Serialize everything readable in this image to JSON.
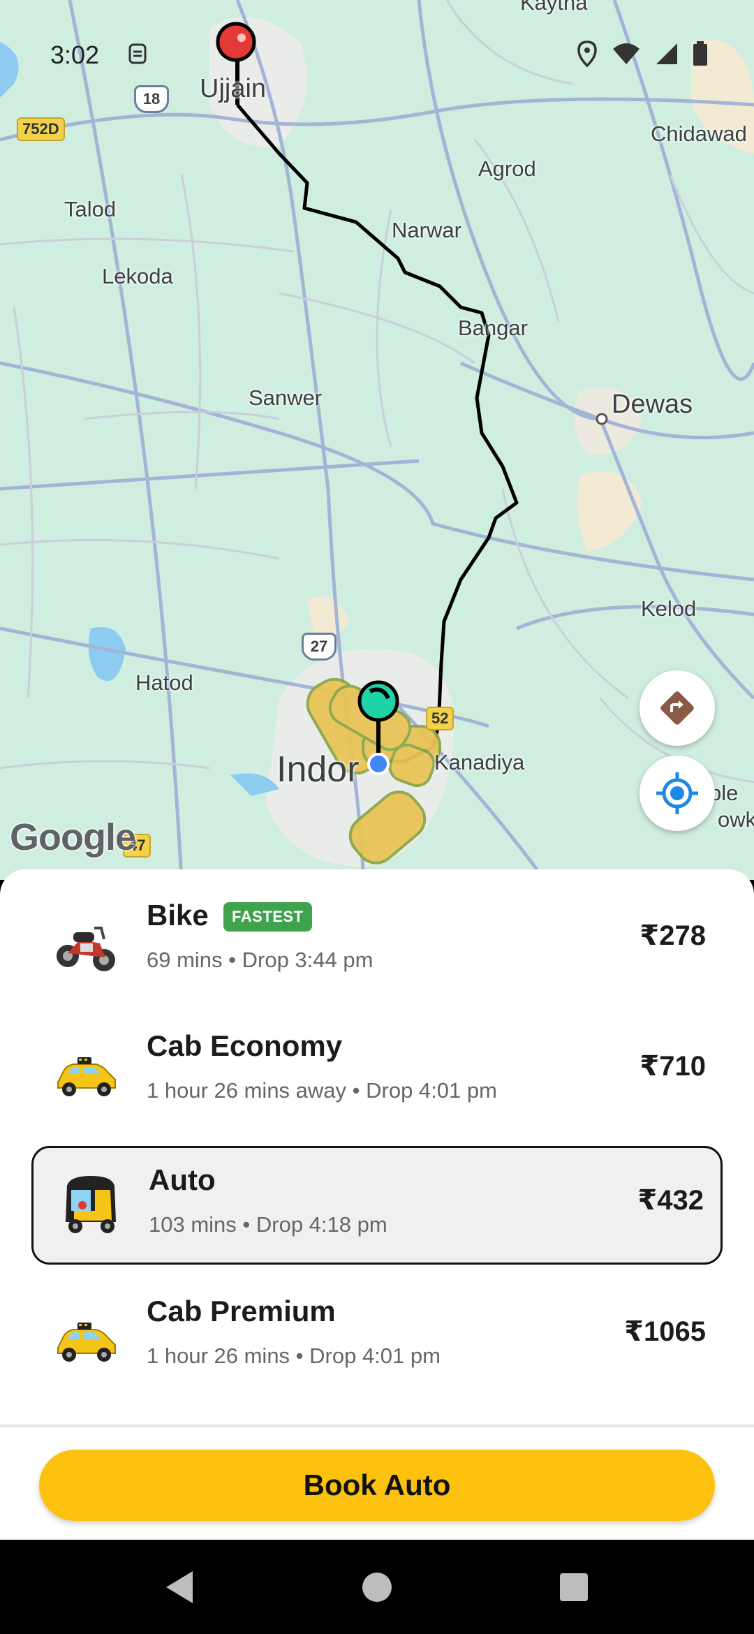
{
  "status_bar": {
    "time": "3:02"
  },
  "map": {
    "labels": {
      "kaytha": "Kaytha",
      "ujjain": "Ujjain",
      "chidawad": "Chidawad",
      "agrod": "Agrod",
      "talod": "Talod",
      "narwar": "Narwar",
      "lekoda": "Lekoda",
      "bangar": "Bangar",
      "sanwer": "Sanwer",
      "dewas": "Dewas",
      "kelod": "Kelod",
      "hatod": "Hatod",
      "kanadiya": "Kanadiya",
      "indore": "Indor",
      "ble": "ble",
      "owki": "owki"
    },
    "shields": {
      "r752d": "752D",
      "nh18": "18",
      "nh27": "27",
      "r52": "52",
      "r47": "47"
    },
    "google_logo": "Google",
    "directions_icon": "directions-icon",
    "locate_icon": "my-location-icon"
  },
  "rides": [
    {
      "name": "Bike",
      "badge": "FASTEST",
      "meta": "69 mins • Drop 3:44 pm",
      "price": "₹278",
      "icon": "bike-icon"
    },
    {
      "name": "Cab Economy",
      "meta": "1 hour 26 mins away • Drop 4:01 pm",
      "price": "₹710",
      "icon": "taxi-icon"
    },
    {
      "name": "Auto",
      "meta": "103 mins • Drop 4:18 pm",
      "price": "₹432",
      "icon": "auto-rickshaw-icon"
    },
    {
      "name": "Cab Premium",
      "meta": "1 hour 26 mins • Drop 4:01 pm",
      "price": "₹1065",
      "icon": "taxi-icon"
    }
  ],
  "selected_ride": "Auto",
  "book_button": {
    "label": "Book Auto"
  },
  "colors": {
    "accent": "#fdc20f",
    "badge": "#3fa34d",
    "route": "#000000",
    "pickup_pin": "#1ed3a6",
    "drop_pin": "#e53935"
  }
}
